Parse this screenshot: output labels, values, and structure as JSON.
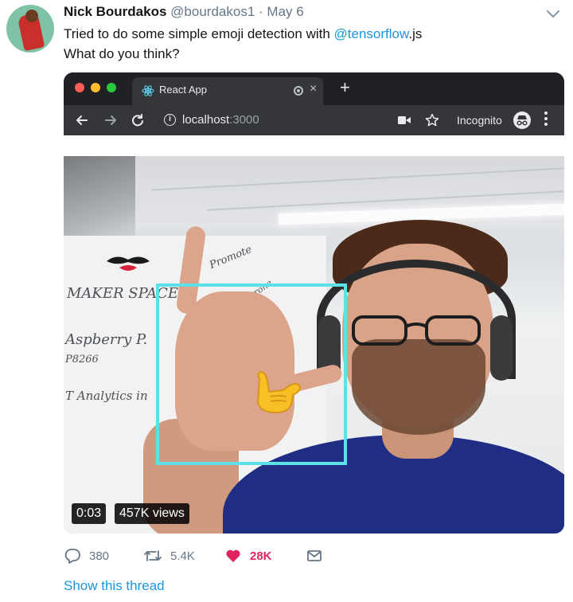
{
  "tweet": {
    "author_name": "Nick Bourdakos",
    "handle": "@bourdakos1",
    "separator": "·",
    "date": "May 6",
    "text_line1_before": "Tried to do some simple emoji detection with ",
    "mention": "@tensorflow",
    "text_line1_after": ".js",
    "text_line2": "What do you think?"
  },
  "browser": {
    "tab_title": "React App",
    "tab_close": "×",
    "new_tab": "+",
    "url_host": "localhost",
    "url_port": ":3000",
    "incognito_label": "Incognito"
  },
  "video": {
    "timestamp": "0:03",
    "views": "457K views",
    "whiteboard_lines": [
      "MAKER SPACES",
      "Aspberry P.",
      "P8266",
      "T Analytics in",
      "Promote",
      "Tello Drone"
    ],
    "box_color": "#5ce1e6"
  },
  "actions": {
    "replies": "380",
    "retweets": "5.4K",
    "likes": "28K",
    "like_color": "#e0245e"
  },
  "footer": {
    "show_thread": "Show this thread"
  },
  "colors": {
    "link": "#1b95e0",
    "muted": "#657786"
  }
}
